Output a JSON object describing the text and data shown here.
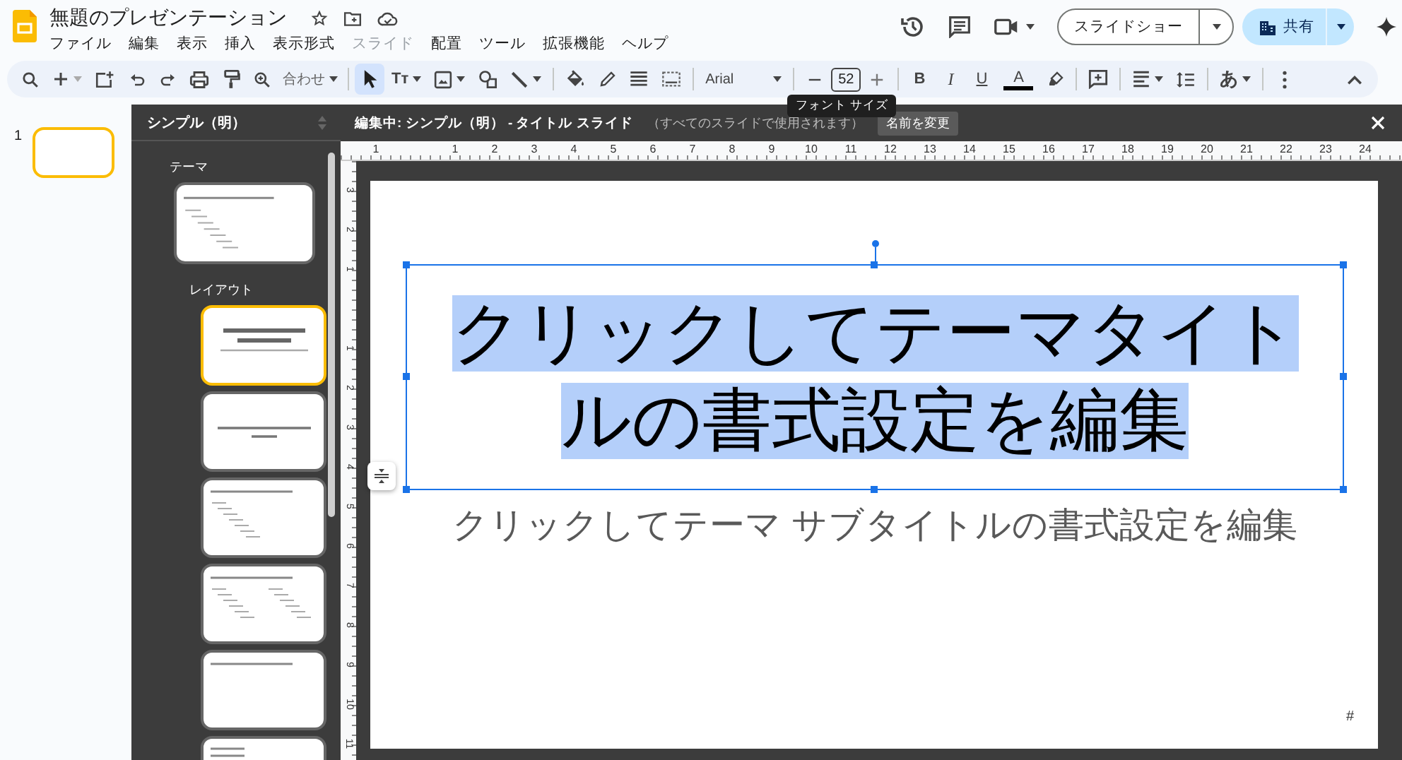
{
  "app": {
    "title": "無題のプレゼンテーション",
    "menu": [
      {
        "label": "ファイル",
        "disabled": false
      },
      {
        "label": "編集",
        "disabled": false
      },
      {
        "label": "表示",
        "disabled": false
      },
      {
        "label": "挿入",
        "disabled": false
      },
      {
        "label": "表示形式",
        "disabled": false
      },
      {
        "label": "スライド",
        "disabled": true
      },
      {
        "label": "配置",
        "disabled": false
      },
      {
        "label": "ツール",
        "disabled": false
      },
      {
        "label": "拡張機能",
        "disabled": false
      },
      {
        "label": "ヘルプ",
        "disabled": false
      }
    ],
    "slideshow_button": "スライドショー",
    "share_button": "共有"
  },
  "toolbar": {
    "items": [
      {
        "kind": "search",
        "caret": false
      },
      {
        "kind": "add",
        "caret": true
      },
      {
        "kind": "new_slide",
        "caret": false
      },
      {
        "kind": "undo",
        "caret": false
      },
      {
        "kind": "redo",
        "caret": false
      },
      {
        "kind": "print",
        "caret": false
      },
      {
        "kind": "paint_format",
        "caret": false
      },
      {
        "kind": "zoom",
        "caret": false
      },
      {
        "kind": "dropdown",
        "label": "合わせ",
        "caret": true
      },
      {
        "kind": "separator"
      },
      {
        "kind": "select",
        "caret": false,
        "selected": true
      },
      {
        "kind": "textbox",
        "label": "Tт",
        "caret": true
      },
      {
        "kind": "image",
        "caret": true
      },
      {
        "kind": "shape",
        "caret": false
      },
      {
        "kind": "line",
        "caret": true
      },
      {
        "kind": "separator"
      },
      {
        "kind": "fill",
        "caret": false
      },
      {
        "kind": "pen",
        "caret": false
      },
      {
        "kind": "border_weight",
        "caret": false
      },
      {
        "kind": "border_dash",
        "caret": false
      },
      {
        "kind": "separator"
      },
      {
        "kind": "font",
        "label": "Arial",
        "caret": true
      },
      {
        "kind": "separator"
      },
      {
        "kind": "minus",
        "caret": false
      },
      {
        "kind": "size",
        "label": "52"
      },
      {
        "kind": "plus",
        "caret": false
      },
      {
        "kind": "separator"
      },
      {
        "kind": "bold",
        "label": "B",
        "caret": false
      },
      {
        "kind": "italic",
        "label": "I",
        "caret": false
      },
      {
        "kind": "underline",
        "label": "U",
        "caret": false
      },
      {
        "kind": "text_color",
        "label": "A",
        "caret": false
      },
      {
        "kind": "highlight",
        "caret": false
      },
      {
        "kind": "separator"
      },
      {
        "kind": "comment",
        "caret": false
      },
      {
        "kind": "separator"
      },
      {
        "kind": "align",
        "caret": true
      },
      {
        "kind": "line_spacing",
        "caret": false
      },
      {
        "kind": "separator"
      },
      {
        "kind": "input_tools",
        "label": "あ",
        "caret": true
      },
      {
        "kind": "separator"
      },
      {
        "kind": "more",
        "caret": false
      },
      {
        "kind": "collapse",
        "caret": false
      }
    ],
    "tooltip": "フォント サイズ"
  },
  "slides": [
    {
      "number": "1",
      "selected": true
    }
  ],
  "theme_panel": {
    "title": "シンプル（明）",
    "theme_label": "テーマ",
    "theme_thumbnail": {
      "kind": "title_body"
    },
    "layout_label": "レイアウト",
    "layouts": [
      {
        "kind": "title",
        "selected": true
      },
      {
        "kind": "section",
        "selected": false
      },
      {
        "kind": "title_body",
        "selected": false
      },
      {
        "kind": "two_columns",
        "selected": false
      },
      {
        "kind": "title_only",
        "selected": false
      },
      {
        "kind": "one_column",
        "selected": false
      }
    ]
  },
  "editor": {
    "editing_label": "編集中: シンプル（明） - タイトル スライド",
    "note": "（すべてのスライドで使用されます）",
    "rename_button": "名前を変更",
    "h_ruler": {
      "negative": [
        "1"
      ],
      "positive": [
        "1",
        "2",
        "3",
        "4",
        "5",
        "6",
        "7",
        "8",
        "9",
        "10",
        "11",
        "12",
        "13",
        "14",
        "15",
        "16",
        "17",
        "18",
        "19",
        "20",
        "21",
        "22",
        "23",
        "24"
      ]
    },
    "v_ruler": {
      "negative": [
        "3",
        "2",
        "1"
      ],
      "positive": [
        "1",
        "2",
        "3",
        "4",
        "5",
        "6",
        "7",
        "8",
        "9",
        "10",
        "11"
      ]
    },
    "slide": {
      "title": "クリックしてテーマタイトルの書式設定を編集",
      "title_selected": true,
      "subtitle": "クリックしてテーマ サブタイトルの書式設定を編集",
      "slide_number": "#"
    }
  }
}
